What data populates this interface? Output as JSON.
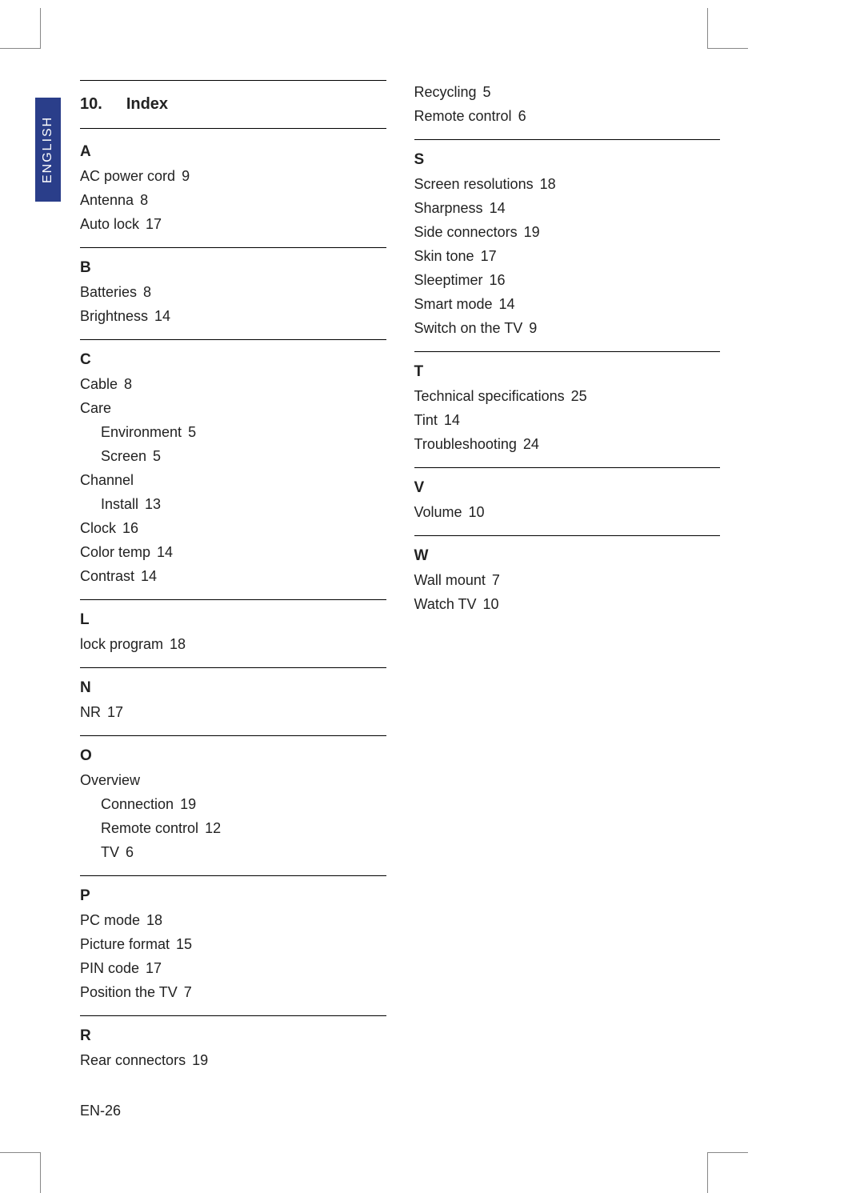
{
  "language_tab": "ENGLISH",
  "page_number": "EN-26",
  "heading": {
    "number": "10.",
    "title": "Index"
  },
  "index": {
    "left": [
      {
        "letter": "A",
        "entries": [
          {
            "term": "AC power cord",
            "page": "9"
          },
          {
            "term": "Antenna",
            "page": "8"
          },
          {
            "term": "Auto lock",
            "page": "17"
          }
        ]
      },
      {
        "letter": "B",
        "entries": [
          {
            "term": "Batteries",
            "page": "8"
          },
          {
            "term": "Brightness",
            "page": "14"
          }
        ]
      },
      {
        "letter": "C",
        "entries": [
          {
            "term": "Cable",
            "page": "8"
          },
          {
            "term": "Care",
            "page": ""
          },
          {
            "term": "Environment",
            "page": "5",
            "sub": true
          },
          {
            "term": "Screen",
            "page": "5",
            "sub": true
          },
          {
            "term": "Channel",
            "page": ""
          },
          {
            "term": "Install",
            "page": "13",
            "sub": true
          },
          {
            "term": "Clock",
            "page": "16"
          },
          {
            "term": "Color temp",
            "page": "14"
          },
          {
            "term": "Contrast",
            "page": "14"
          }
        ]
      },
      {
        "letter": "L",
        "entries": [
          {
            "term": "lock program",
            "page": "18"
          }
        ]
      },
      {
        "letter": "N",
        "entries": [
          {
            "term": "NR",
            "page": "17"
          }
        ]
      },
      {
        "letter": "O",
        "entries": [
          {
            "term": "Overview",
            "page": ""
          },
          {
            "term": "Connection",
            "page": "19",
            "sub": true
          },
          {
            "term": "Remote control",
            "page": "12",
            "sub": true
          },
          {
            "term": "TV",
            "page": "6",
            "sub": true
          }
        ]
      },
      {
        "letter": "P",
        "entries": [
          {
            "term": "PC mode",
            "page": "18"
          },
          {
            "term": "Picture format",
            "page": "15"
          },
          {
            "term": "PIN code",
            "page": "17"
          },
          {
            "term": "Position the TV",
            "page": "7"
          }
        ]
      },
      {
        "letter": "R",
        "entries": [
          {
            "term": "Rear connectors",
            "page": "19"
          }
        ]
      }
    ],
    "right_pre": [
      {
        "term": "Recycling",
        "page": "5"
      },
      {
        "term": "Remote control",
        "page": "6"
      }
    ],
    "right": [
      {
        "letter": "S",
        "entries": [
          {
            "term": "Screen resolutions",
            "page": "18"
          },
          {
            "term": "Sharpness",
            "page": "14"
          },
          {
            "term": "Side connectors",
            "page": "19"
          },
          {
            "term": "Skin tone",
            "page": "17"
          },
          {
            "term": "Sleeptimer",
            "page": "16"
          },
          {
            "term": "Smart mode",
            "page": "14"
          },
          {
            "term": "Switch on the TV",
            "page": "9"
          }
        ]
      },
      {
        "letter": "T",
        "entries": [
          {
            "term": "Technical specifications",
            "page": "25"
          },
          {
            "term": "Tint",
            "page": "14"
          },
          {
            "term": "Troubleshooting",
            "page": "24"
          }
        ]
      },
      {
        "letter": "V",
        "entries": [
          {
            "term": "Volume",
            "page": "10"
          }
        ]
      },
      {
        "letter": "W",
        "entries": [
          {
            "term": "Wall mount",
            "page": "7"
          },
          {
            "term": "Watch TV",
            "page": "10"
          }
        ]
      }
    ]
  }
}
